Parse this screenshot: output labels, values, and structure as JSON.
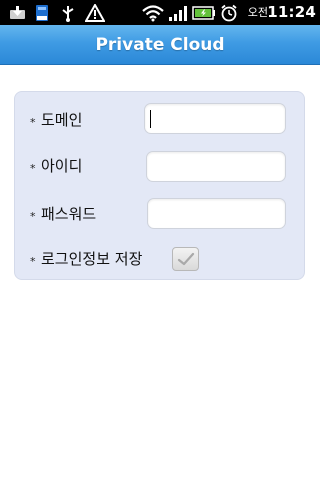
{
  "status_bar": {
    "icons": [
      "download-icon",
      "storage-icon",
      "usb-icon",
      "warning-icon",
      "wifi-icon",
      "signal-icon",
      "battery-icon",
      "alarm-icon"
    ],
    "ampm": "오전",
    "time": "11:24"
  },
  "title_bar": {
    "title": "Private Cloud"
  },
  "form": {
    "bullet": "*",
    "domain_label": "도메인",
    "domain_value": "",
    "id_label": "아이디",
    "id_value": "",
    "password_label": "패스워드",
    "password_value": "",
    "save_login_label": "로그인정보 저장",
    "save_login_checked": true
  },
  "colors": {
    "title_bar": "#3f9be4",
    "panel": "#e3e8f6",
    "battery": "#63c13b"
  }
}
